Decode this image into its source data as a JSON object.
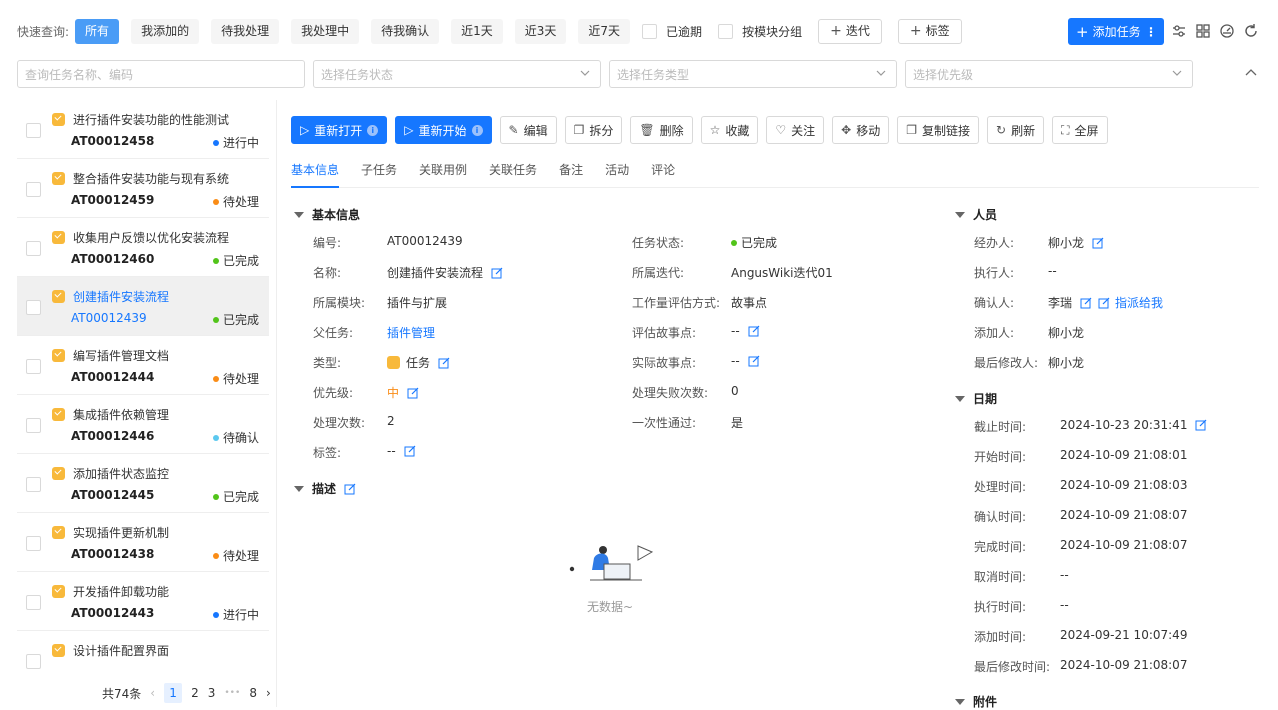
{
  "quick": {
    "label": "快速查询:",
    "buttons": [
      "所有",
      "我添加的",
      "待我处理",
      "我处理中",
      "待我确认",
      "近1天",
      "近3天",
      "近7天"
    ],
    "checkboxes": [
      "已逾期",
      "按模块分组"
    ],
    "outline_buttons": [
      "迭代",
      "标签"
    ],
    "add_task": "添加任务"
  },
  "filters": {
    "search_placeholder": "查询任务名称、编码",
    "status_placeholder": "选择任务状态",
    "type_placeholder": "选择任务类型",
    "priority_placeholder": "选择优先级"
  },
  "tasks": [
    {
      "title": "进行插件安装功能的性能测试",
      "code": "AT00012458",
      "status": "进行中",
      "color": "#1677ff"
    },
    {
      "title": "整合插件安装功能与现有系统",
      "code": "AT00012459",
      "status": "待处理",
      "color": "#fa8c16"
    },
    {
      "title": "收集用户反馈以优化安装流程",
      "code": "AT00012460",
      "status": "已完成",
      "color": "#52c41a"
    },
    {
      "title": "创建插件安装流程",
      "code": "AT00012439",
      "status": "已完成",
      "color": "#52c41a"
    },
    {
      "title": "编写插件管理文档",
      "code": "AT00012444",
      "status": "待处理",
      "color": "#fa8c16"
    },
    {
      "title": "集成插件依赖管理",
      "code": "AT00012446",
      "status": "待确认",
      "color": "#5bc8ef"
    },
    {
      "title": "添加插件状态监控",
      "code": "AT00012445",
      "status": "已完成",
      "color": "#52c41a"
    },
    {
      "title": "实现插件更新机制",
      "code": "AT00012438",
      "status": "待处理",
      "color": "#fa8c16"
    },
    {
      "title": "开发插件卸载功能",
      "code": "AT00012443",
      "status": "进行中",
      "color": "#1677ff"
    },
    {
      "title": "设计插件配置界面",
      "code": "",
      "status": "",
      "color": ""
    }
  ],
  "pager": {
    "total": "共74条",
    "pages": [
      "1",
      "2",
      "3",
      "•••",
      "8"
    ]
  },
  "actions": [
    "重新打开",
    "重新开始",
    "编辑",
    "拆分",
    "删除",
    "收藏",
    "关注",
    "移动",
    "复制链接",
    "刷新",
    "全屏"
  ],
  "tabs": [
    "基本信息",
    "子任务",
    "关联用例",
    "关联任务",
    "备注",
    "活动",
    "评论"
  ],
  "basic": {
    "title": "基本信息",
    "code_label": "编号:",
    "code": "AT00012439",
    "name_label": "名称:",
    "name": "创建插件安装流程",
    "module_label": "所属模块:",
    "module": "插件与扩展",
    "parent_label": "父任务:",
    "parent": "插件管理",
    "type_label": "类型:",
    "type": "任务",
    "priority_label": "优先级:",
    "priority": "中",
    "count_label": "处理次数:",
    "count": "2",
    "tag_label": "标签:",
    "tag": "--",
    "status_label": "任务状态:",
    "status": "已完成",
    "sprint_label": "所属迭代:",
    "sprint": "AngusWiki迭代01",
    "method_label": "工作量评估方式:",
    "method": "故事点",
    "eval_label": "评估故事点:",
    "eval": "--",
    "actual_label": "实际故事点:",
    "actual": "--",
    "fail_label": "处理失败次数:",
    "fail": "0",
    "once_label": "一次性通过:",
    "once": "是"
  },
  "desc": {
    "title": "描述",
    "empty": "无数据~"
  },
  "people": {
    "title": "人员",
    "assignee_label": "经办人:",
    "assignee": "柳小龙",
    "executor_label": "执行人:",
    "executor": "--",
    "confirmer_label": "确认人:",
    "confirmer": "李瑞",
    "assign_me": "指派给我",
    "creator_label": "添加人:",
    "creator": "柳小龙",
    "modifier_label": "最后修改人:",
    "modifier": "柳小龙"
  },
  "dates": {
    "title": "日期",
    "items": [
      {
        "label": "截止时间:",
        "value": "2024-10-23 20:31:41"
      },
      {
        "label": "开始时间:",
        "value": "2024-10-09 21:08:01"
      },
      {
        "label": "处理时间:",
        "value": "2024-10-09 21:08:03"
      },
      {
        "label": "确认时间:",
        "value": "2024-10-09 21:08:07"
      },
      {
        "label": "完成时间:",
        "value": "2024-10-09 21:08:07"
      },
      {
        "label": "取消时间:",
        "value": "--"
      },
      {
        "label": "执行时间:",
        "value": "--"
      },
      {
        "label": "添加时间:",
        "value": "2024-09-21 10:07:49"
      },
      {
        "label": "最后修改时间:",
        "value": "2024-10-09 21:08:07"
      }
    ]
  },
  "attach": {
    "title": "附件"
  },
  "colors": {
    "primary": "#1677ff",
    "done": "#52c41a",
    "pending": "#fa8c16",
    "confirm": "#5bc8ef"
  }
}
